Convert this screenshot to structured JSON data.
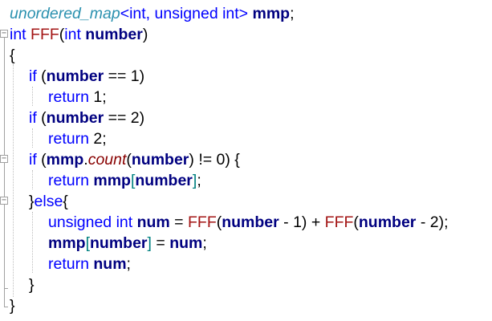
{
  "code": {
    "line1": {
      "type": "unordered_map",
      "template": "<int, unsigned int>",
      "var": "mmp",
      "end": ";"
    },
    "line2": {
      "ret": "int",
      "fn": "FFF",
      "open": "(",
      "ptype": "int",
      "pname": "number",
      "close": ")"
    },
    "line3": {
      "text": "{"
    },
    "line4": {
      "kw": "if",
      "open": " (",
      "p": "number",
      "op": " == 1)"
    },
    "line5": {
      "kw": "return",
      "rest": " 1;"
    },
    "line6": {
      "kw": "if",
      "open": " (",
      "p": "number",
      "op": " == 2)"
    },
    "line7": {
      "kw": "return",
      "rest": " 2;"
    },
    "line8": {
      "kw": "if",
      "open": " (",
      "obj": "mmp",
      "dot": ".",
      "method": "count",
      "popen": "(",
      "p": "number",
      "rest": ") != 0) {"
    },
    "line9": {
      "kw": "return",
      "sp": " ",
      "obj": "mmp",
      "lb": "[",
      "p": "number",
      "rb": "]",
      "end": ";"
    },
    "line10": {
      "pre": "}",
      "kw": "else",
      "post": "{"
    },
    "line11": {
      "kw": "unsigned int",
      "sp": " ",
      "var": "num",
      "eq": " = ",
      "fn1": "FFF",
      "o1": "(",
      "p1": "number",
      "m1": " - 1) + ",
      "fn2": "FFF",
      "o2": "(",
      "p2": "number",
      "m2": " - 2);"
    },
    "line12": {
      "obj": "mmp",
      "lb": "[",
      "p": "number",
      "rb": "]",
      "eq": " = ",
      "var": "num",
      "end": ";"
    },
    "line13": {
      "kw": "return",
      "sp": " ",
      "var": "num",
      "end": ";"
    },
    "line14": {
      "text": "}"
    },
    "line15": {
      "text": "}"
    }
  },
  "fold_markers": {
    "collapse": "−"
  },
  "colors": {
    "keyword": "#0000ff",
    "type": "#2b91af",
    "function": "#a31515",
    "method": "#880000",
    "parameter": "#000080",
    "bracket": "#008080"
  }
}
